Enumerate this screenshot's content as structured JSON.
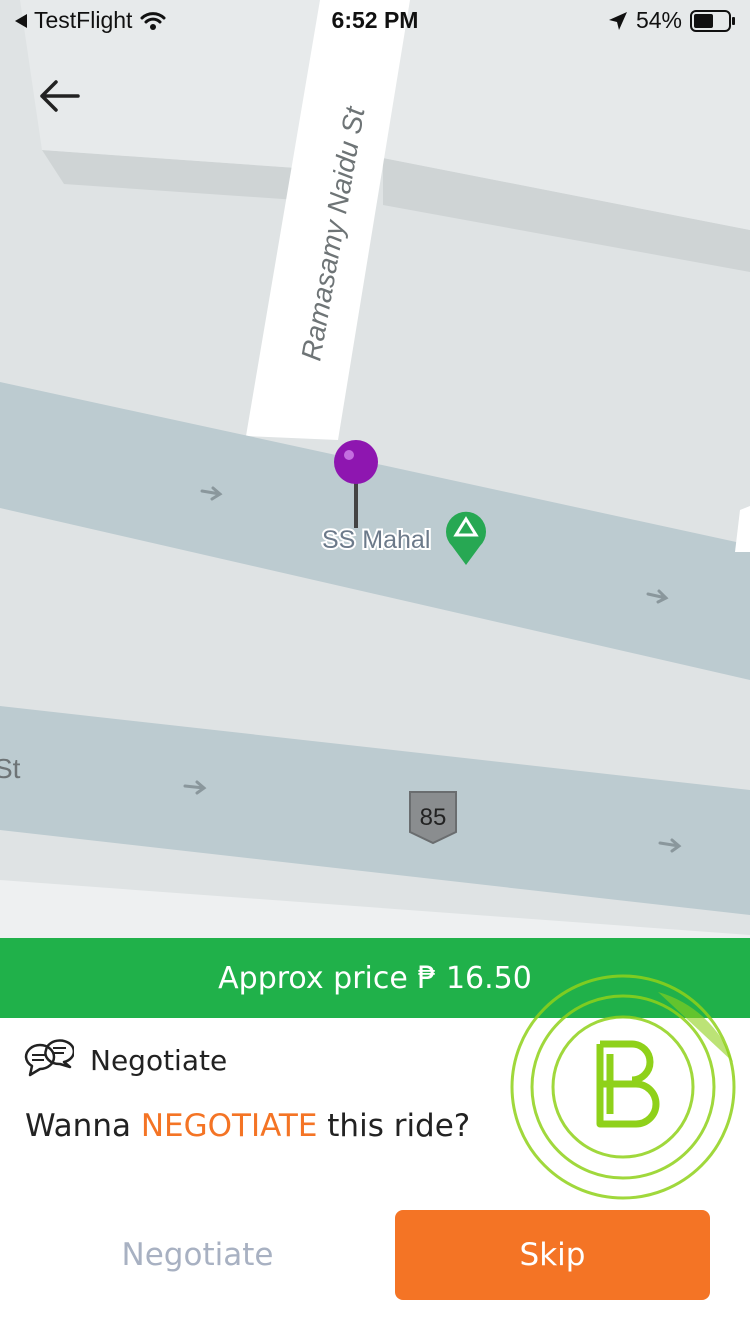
{
  "status_bar": {
    "back_app": "TestFlight",
    "time": "6:52 PM",
    "battery": "54%"
  },
  "map": {
    "street_name": "Ramasamy Naidu St",
    "edge_street_fragment": "St",
    "place_name": "SS Mahal",
    "route_shield": "85",
    "pin_color": "#8e16b0",
    "place_icon": "campground-marker-icon"
  },
  "price": {
    "label": "Approx price ₱ 16.50"
  },
  "negotiate_panel": {
    "title": "Negotiate",
    "question_prefix": "Wanna ",
    "question_highlight": "NEGOTIATE",
    "question_suffix": " this ride?",
    "icon": "chat-bubbles-icon"
  },
  "actions": {
    "negotiate_label": "Negotiate",
    "skip_label": "Skip"
  },
  "colors": {
    "accent": "#f47425",
    "price_bar": "#20b14a",
    "muted_text": "#a8b1c2"
  }
}
